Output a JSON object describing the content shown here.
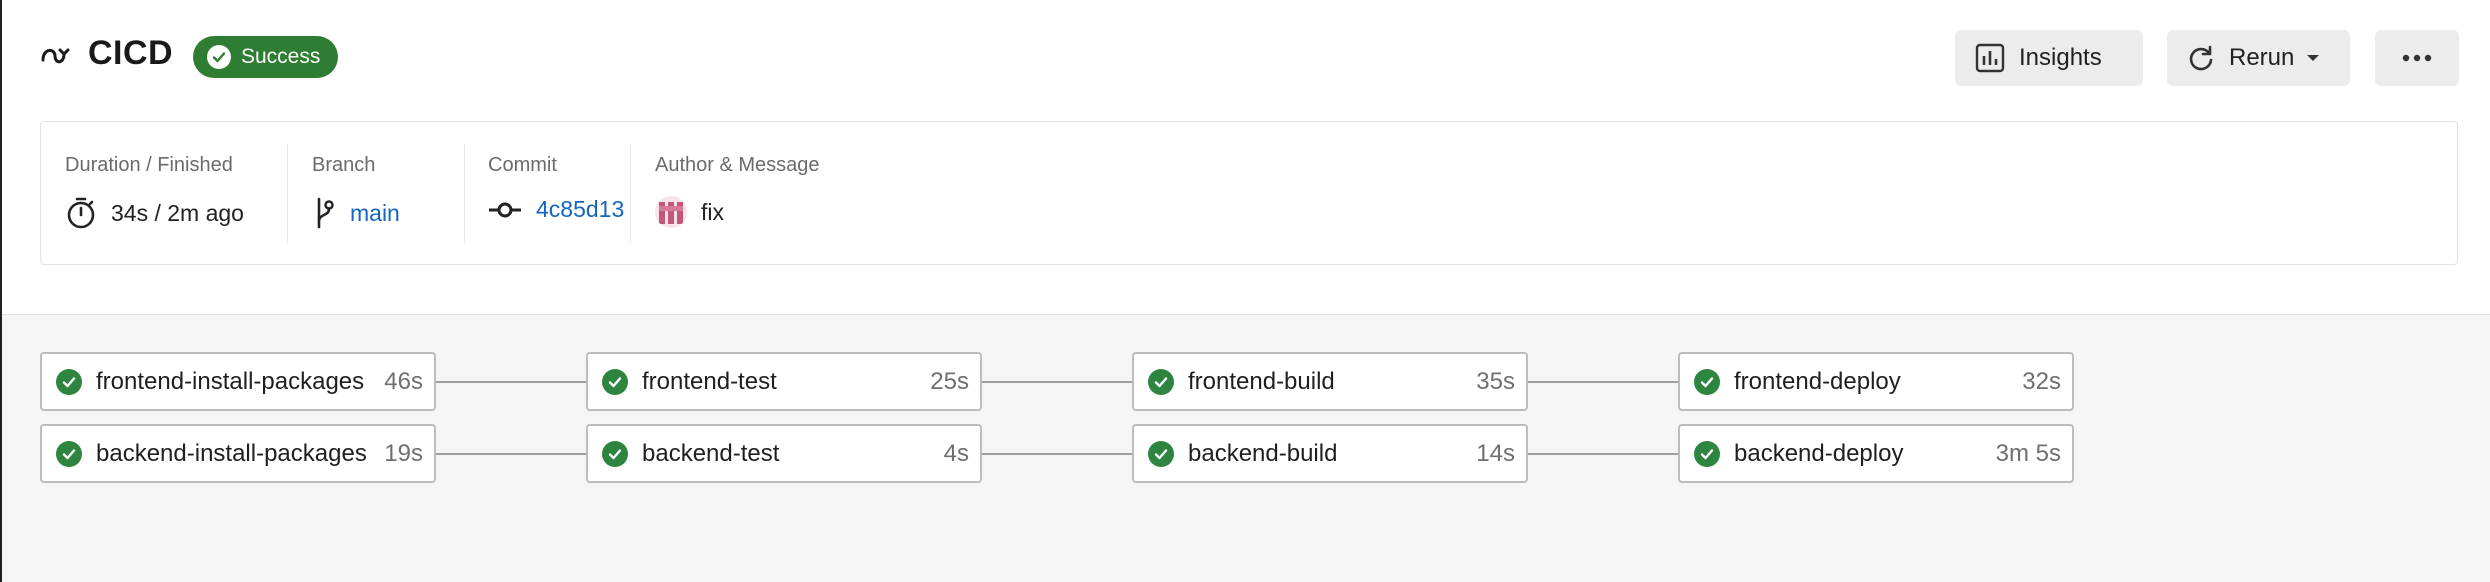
{
  "header": {
    "title": "CICD",
    "status": "Success",
    "buttons": {
      "insights": "Insights",
      "rerun": "Rerun"
    }
  },
  "info": {
    "duration": {
      "label": "Duration / Finished",
      "value": "34s / 2m ago"
    },
    "branch": {
      "label": "Branch",
      "value": "main"
    },
    "commit": {
      "label": "Commit",
      "value": "4c85d13"
    },
    "author": {
      "label": "Author & Message",
      "value": "fix"
    }
  },
  "pipeline": {
    "rows": [
      [
        {
          "name": "frontend-install-packages",
          "duration": "46s",
          "status": "success"
        },
        {
          "name": "frontend-test",
          "duration": "25s",
          "status": "success"
        },
        {
          "name": "frontend-build",
          "duration": "35s",
          "status": "success"
        },
        {
          "name": "frontend-deploy",
          "duration": "32s",
          "status": "success"
        }
      ],
      [
        {
          "name": "backend-install-packages",
          "duration": "19s",
          "status": "success"
        },
        {
          "name": "backend-test",
          "duration": "4s",
          "status": "success"
        },
        {
          "name": "backend-build",
          "duration": "14s",
          "status": "success"
        },
        {
          "name": "backend-deploy",
          "duration": "3m 5s",
          "status": "success"
        }
      ]
    ]
  },
  "colors": {
    "success": "#2e7d32",
    "link": "#1565c0",
    "canvas_bg": "#f5f5f5"
  },
  "icons": {
    "pipeline": "pipeline-icon",
    "success": "check-circle-icon",
    "insights": "bar-chart-icon",
    "rerun": "refresh-icon",
    "more": "ellipsis-icon",
    "duration": "stopwatch-icon",
    "branch": "git-branch-icon",
    "commit": "git-commit-icon",
    "author": "avatar"
  }
}
